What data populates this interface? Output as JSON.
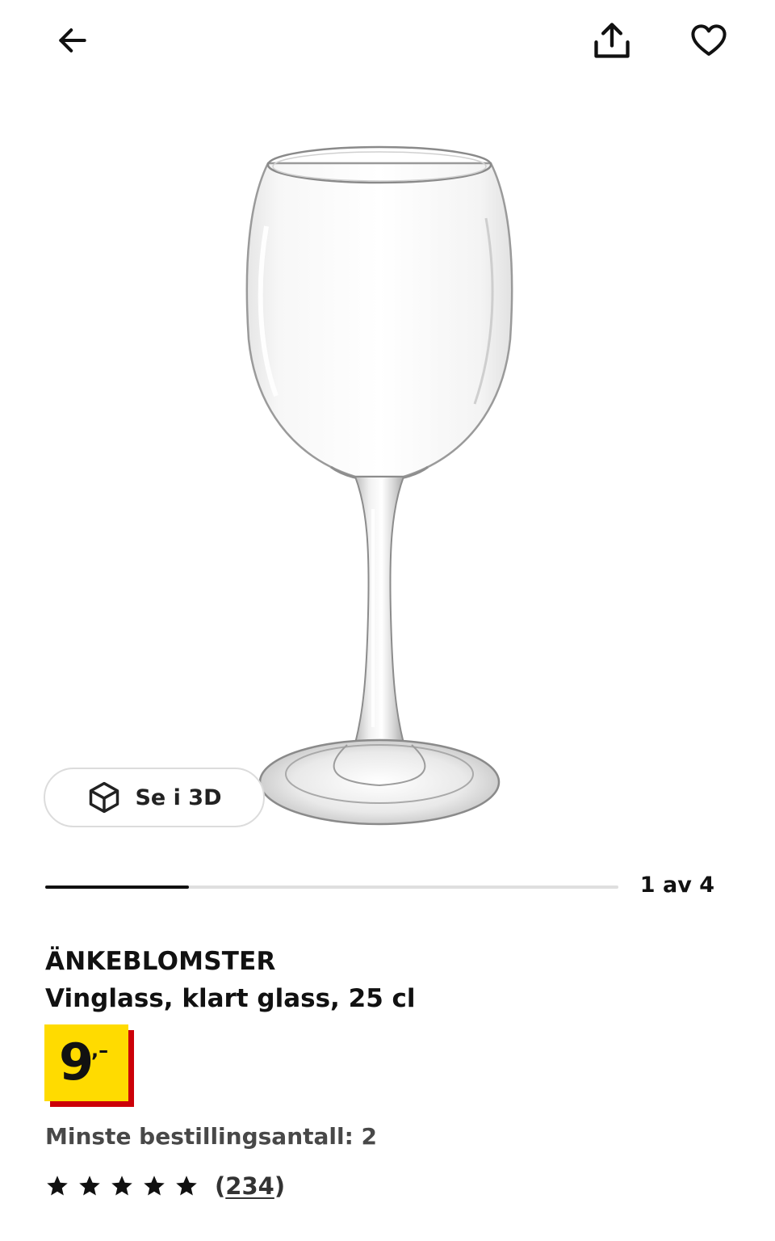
{
  "header": {
    "back_icon": "arrow-left-icon",
    "share_icon": "share-upload-icon",
    "favorite_icon": "heart-outline-icon"
  },
  "gallery": {
    "image_subject": "wine-glass",
    "view3d_label": "Se i 3D",
    "view3d_icon": "cube-3d-icon",
    "page_indicator": "1 av 4",
    "current_page": 1,
    "total_pages": 4
  },
  "product": {
    "name": "ÄNKEBLOMSTER",
    "description": "Vinglass, klart glass, 25 cl",
    "price": "9",
    "price_suffix": ",–",
    "price_bg_color": "#ffdb00",
    "price_shadow_color": "#cc0008",
    "min_order": "Minste bestillingsantall: 2"
  },
  "rating": {
    "stars": 5,
    "star_icon": "star-filled-icon",
    "review_count_open": "(",
    "review_count": "234",
    "review_count_close": ")"
  }
}
